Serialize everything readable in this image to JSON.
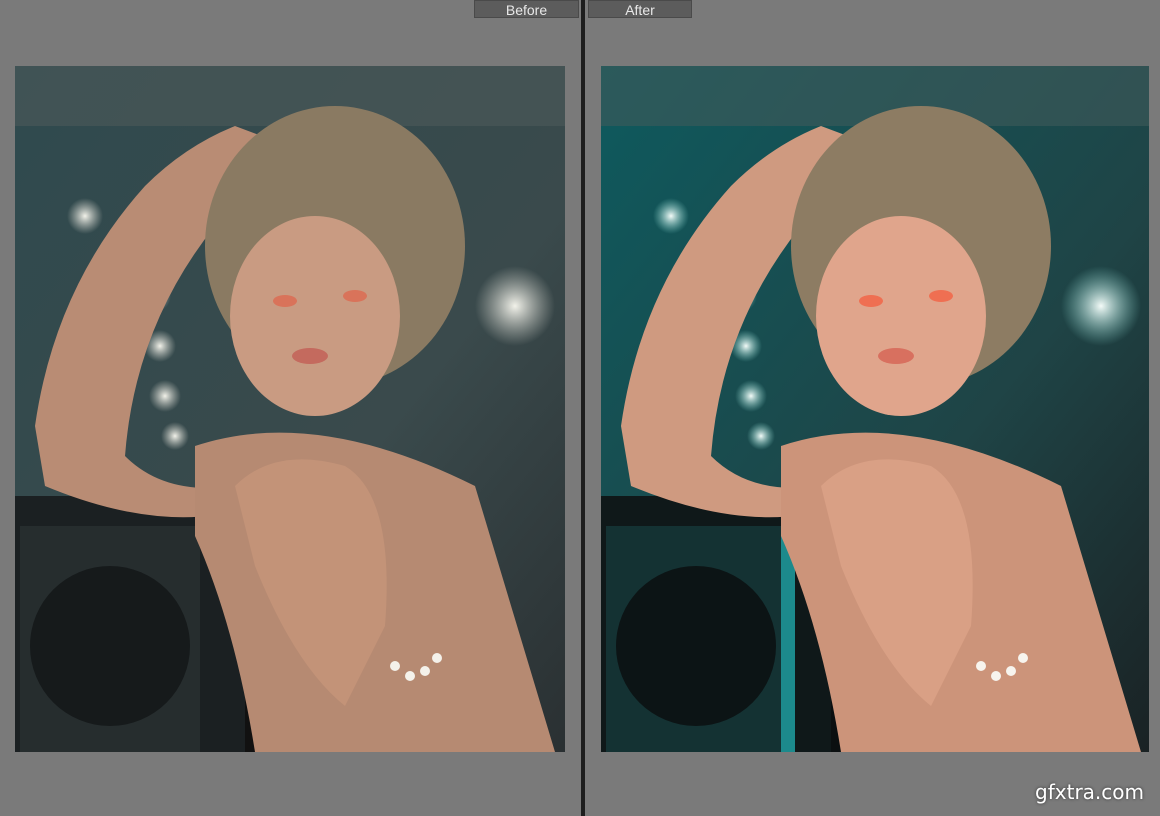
{
  "labels": {
    "before": "Before",
    "after": "After"
  },
  "watermark": "gfxtra.com",
  "images": {
    "before": {
      "description_icon": "portrait-photo",
      "tone": "muted"
    },
    "after": {
      "description_icon": "portrait-photo",
      "tone": "teal-orange"
    }
  },
  "colors": {
    "workspace_bg": "#7a7a7a",
    "label_bg": "#5c5c5c",
    "divider": "#1e1e1e",
    "before_wall": "#2e4b4f",
    "after_wall": "#0f5a5e",
    "skin_before": "#c99b82",
    "skin_after": "#e0a58c"
  }
}
